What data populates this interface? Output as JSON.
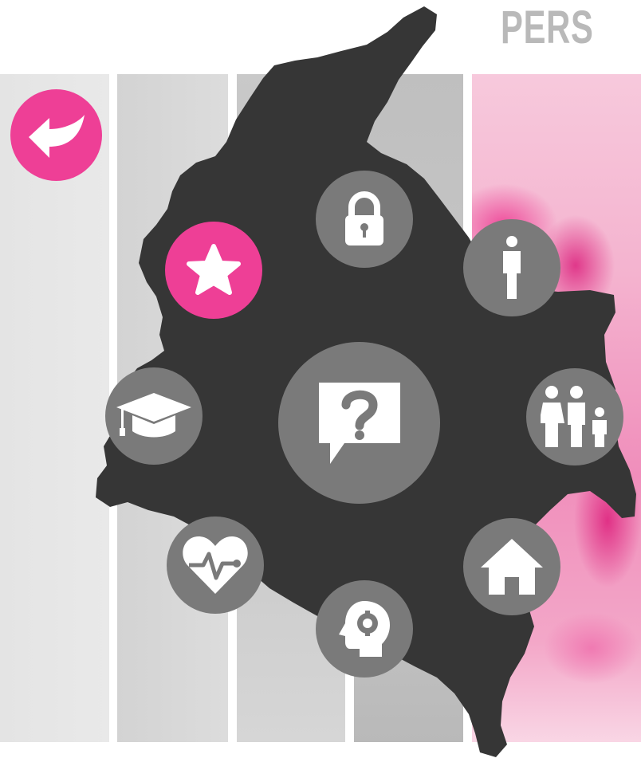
{
  "header": {
    "title": "PERS"
  },
  "colors": {
    "accent": "#ee3f96",
    "icon_bg": "#7a7a7a",
    "map": "#363636",
    "icon_fg": "#ffffff"
  },
  "icons": {
    "back": "back-arrow-icon",
    "favorite": "star-icon",
    "security": "lock-icon",
    "person": "person-icon",
    "help": "question-chat-icon",
    "education": "graduation-cap-icon",
    "family": "family-icon",
    "health": "heart-pulse-icon",
    "mental": "head-gear-icon",
    "home": "house-icon"
  }
}
